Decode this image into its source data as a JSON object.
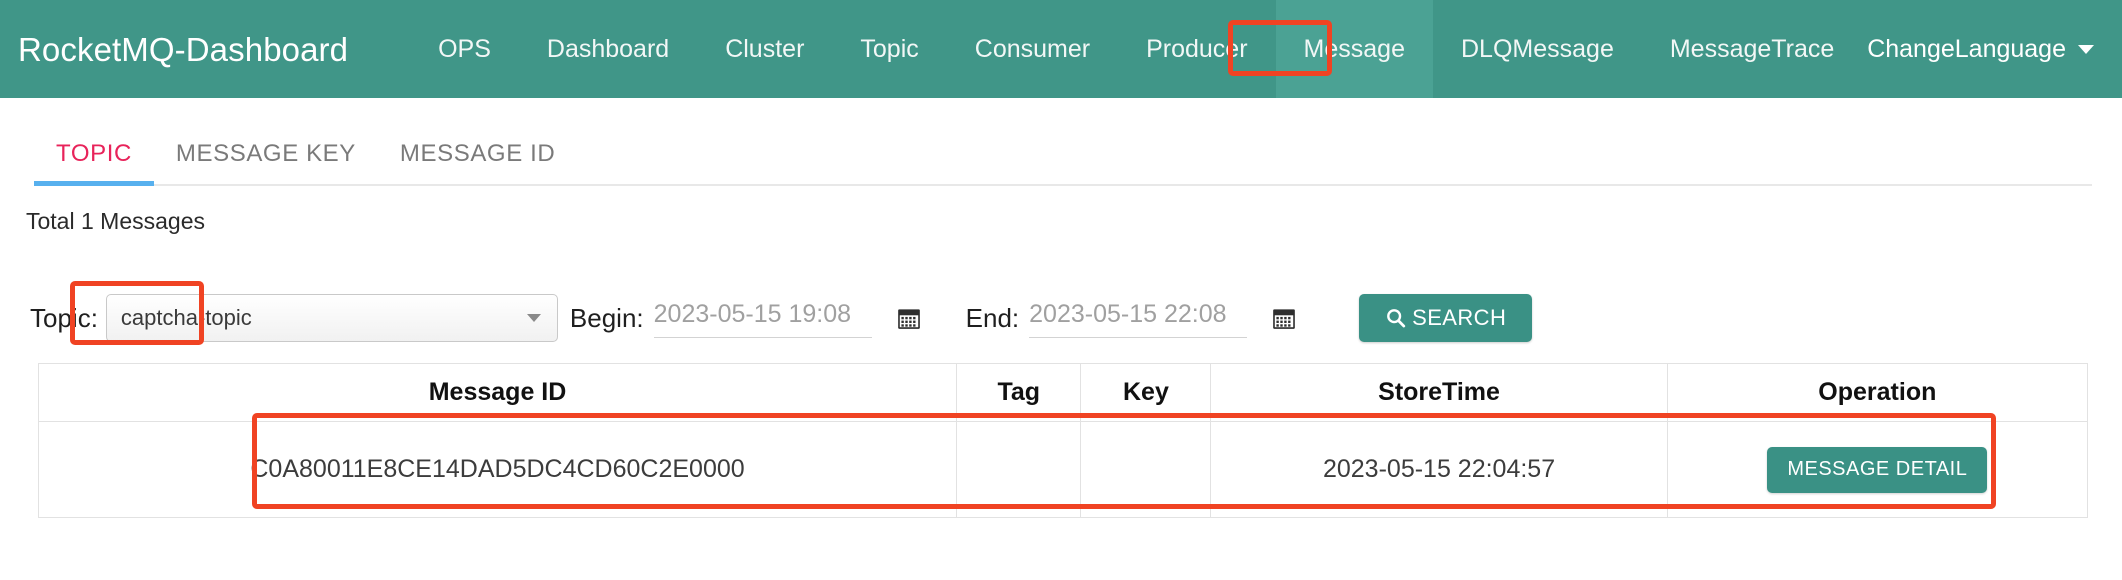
{
  "navbar": {
    "brand": "RocketMQ-Dashboard",
    "links": [
      {
        "label": "OPS",
        "active": false
      },
      {
        "label": "Dashboard",
        "active": false
      },
      {
        "label": "Cluster",
        "active": false
      },
      {
        "label": "Topic",
        "active": false
      },
      {
        "label": "Consumer",
        "active": false
      },
      {
        "label": "Producer",
        "active": false
      },
      {
        "label": "Message",
        "active": true
      },
      {
        "label": "DLQMessage",
        "active": false
      },
      {
        "label": "MessageTrace",
        "active": false
      }
    ],
    "language": "ChangeLanguage",
    "background_color": "#409688",
    "active_background_color": "#4ba294"
  },
  "tabs": [
    {
      "label": "TOPIC",
      "active": true
    },
    {
      "label": "MESSAGE KEY",
      "active": false
    },
    {
      "label": "MESSAGE ID",
      "active": false
    }
  ],
  "tab_active_color": "#e8235a",
  "tab_underline_color": "#57b0ee",
  "summary": {
    "total_text": "Total 1 Messages"
  },
  "filter": {
    "topic_label": "Topic:",
    "topic_value": "captcha-topic",
    "begin_label": "Begin:",
    "begin_placeholder": "2023-05-15 19:08",
    "begin_value": "",
    "end_label": "End:",
    "end_placeholder": "2023-05-15 22:08",
    "end_value": "",
    "search_label": "SEARCH",
    "search_icon": "search-icon",
    "calendar_icon": "calendar-icon",
    "button_color": "#3a9185"
  },
  "table": {
    "headers": [
      "Message ID",
      "Tag",
      "Key",
      "StoreTime",
      "Operation"
    ],
    "rows": [
      {
        "message_id": "C0A80011E8CE14DAD5DC4CD60C2E0000",
        "tag": "",
        "key": "",
        "store_time": "2023-05-15 22:04:57",
        "operation_label": "MESSAGE DETAIL"
      }
    ]
  },
  "annotations": {
    "color": "#f04323",
    "boxes": [
      {
        "name": "message-nav-highlight"
      },
      {
        "name": "topic-select-highlight"
      },
      {
        "name": "message-row-highlight"
      }
    ]
  }
}
